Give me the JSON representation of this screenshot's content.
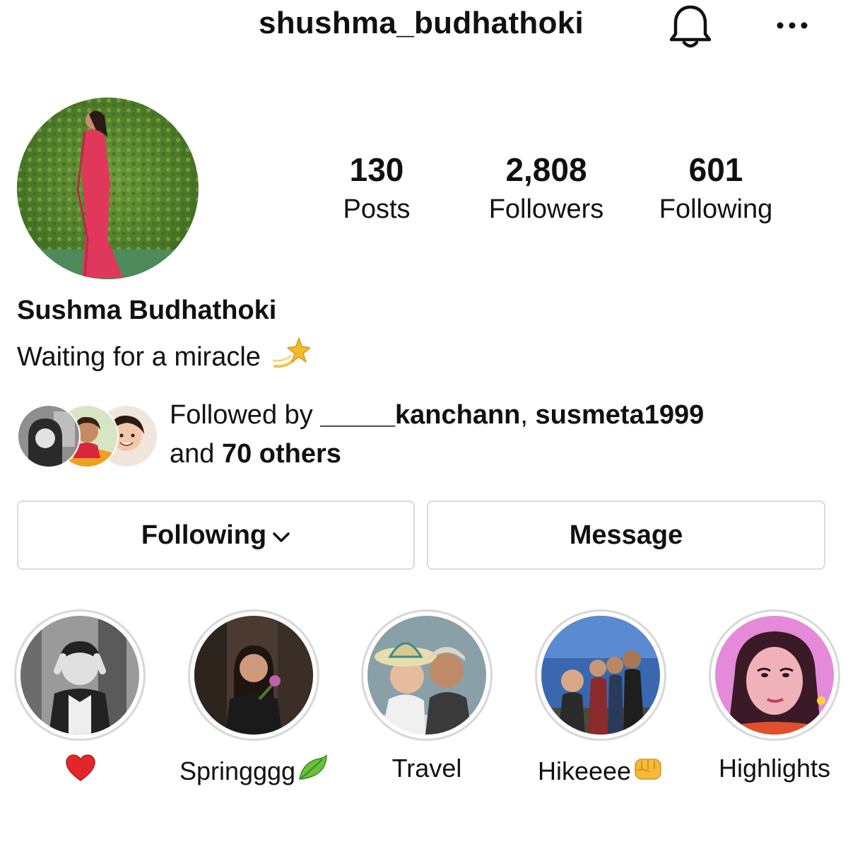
{
  "header": {
    "username": "shushma_budhathoki",
    "notification_icon": "bell-icon",
    "more_icon": "more-options-icon"
  },
  "profile": {
    "stats": [
      {
        "value": "130",
        "label": "Posts"
      },
      {
        "value": "2,808",
        "label": "Followers"
      },
      {
        "value": "601",
        "label": "Following"
      }
    ],
    "full_name": "Sushma Budhathoki",
    "bio": "Waiting for a miracle",
    "bio_emoji_icon": "dizzy-star-emoji"
  },
  "followed_by": {
    "prefix": "Followed by ",
    "user1": "_____kanchann",
    "separator": ", ",
    "user2": "susmeta1999",
    "middle": " and ",
    "others": "70 others"
  },
  "actions": {
    "following_label": "Following",
    "following_icon": "chevron-down-icon",
    "message_label": "Message"
  },
  "highlights": [
    {
      "label": "",
      "emoji": "red-heart-emoji"
    },
    {
      "label": "Springggg",
      "emoji": "leaf-emoji"
    },
    {
      "label": "Travel"
    },
    {
      "label": "Hikeeee",
      "emoji": "fist-emoji"
    },
    {
      "label": "Highlights"
    }
  ],
  "colors": {
    "text": "#111111",
    "border": "#dbdbdb",
    "ring": "#d8d8d8"
  }
}
